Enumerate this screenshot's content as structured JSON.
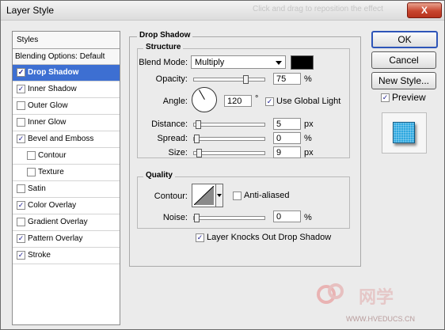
{
  "window": {
    "title": "Layer Style",
    "ghost_text": "Click and drag to reposition the effect",
    "close_label": "X"
  },
  "styles_panel": {
    "header": "Styles",
    "blending_options": "Blending Options: Default",
    "items": [
      {
        "label": "Drop Shadow",
        "checked": true,
        "selected": true,
        "indent": false
      },
      {
        "label": "Inner Shadow",
        "checked": true,
        "selected": false,
        "indent": false
      },
      {
        "label": "Outer Glow",
        "checked": false,
        "selected": false,
        "indent": false
      },
      {
        "label": "Inner Glow",
        "checked": false,
        "selected": false,
        "indent": false
      },
      {
        "label": "Bevel and Emboss",
        "checked": true,
        "selected": false,
        "indent": false
      },
      {
        "label": "Contour",
        "checked": false,
        "selected": false,
        "indent": true
      },
      {
        "label": "Texture",
        "checked": false,
        "selected": false,
        "indent": true
      },
      {
        "label": "Satin",
        "checked": false,
        "selected": false,
        "indent": false
      },
      {
        "label": "Color Overlay",
        "checked": true,
        "selected": false,
        "indent": false
      },
      {
        "label": "Gradient Overlay",
        "checked": false,
        "selected": false,
        "indent": false
      },
      {
        "label": "Pattern Overlay",
        "checked": true,
        "selected": false,
        "indent": false
      },
      {
        "label": "Stroke",
        "checked": true,
        "selected": false,
        "indent": false
      }
    ]
  },
  "drop_shadow": {
    "title": "Drop Shadow",
    "structure": {
      "title": "Structure",
      "blend_mode_label": "Blend Mode:",
      "blend_mode_value": "Multiply",
      "shadow_color": "#000000",
      "opacity_label": "Opacity:",
      "opacity_value": "75",
      "opacity_unit": "%",
      "opacity_level": 0.75,
      "angle_label": "Angle:",
      "angle_value": "120",
      "angle_unit": "°",
      "global_light_label": "Use Global Light",
      "global_light_checked": true,
      "distance_label": "Distance:",
      "distance_value": "5",
      "distance_unit": "px",
      "distance_level": 0.02,
      "spread_label": "Spread:",
      "spread_value": "0",
      "spread_unit": "%",
      "spread_level": 0.0,
      "size_label": "Size:",
      "size_value": "9",
      "size_unit": "px",
      "size_level": 0.04
    },
    "quality": {
      "title": "Quality",
      "contour_label": "Contour:",
      "anti_aliased_label": "Anti-aliased",
      "anti_aliased_checked": false,
      "noise_label": "Noise:",
      "noise_value": "0",
      "noise_unit": "%",
      "noise_level": 0.0
    },
    "knockout_label": "Layer Knocks Out Drop Shadow",
    "knockout_checked": true
  },
  "buttons": {
    "ok": "OK",
    "cancel": "Cancel",
    "new_style": "New Style..."
  },
  "preview": {
    "label": "Preview",
    "checked": true
  },
  "watermark": {
    "brand": "网学",
    "url": "WWW.HVEDUCS.CN"
  },
  "colors": {
    "selection": "#3d6fd2",
    "close": "#c8462f",
    "ok_border": "#2e55b8",
    "preview_swatch": "#2ea8e0"
  }
}
